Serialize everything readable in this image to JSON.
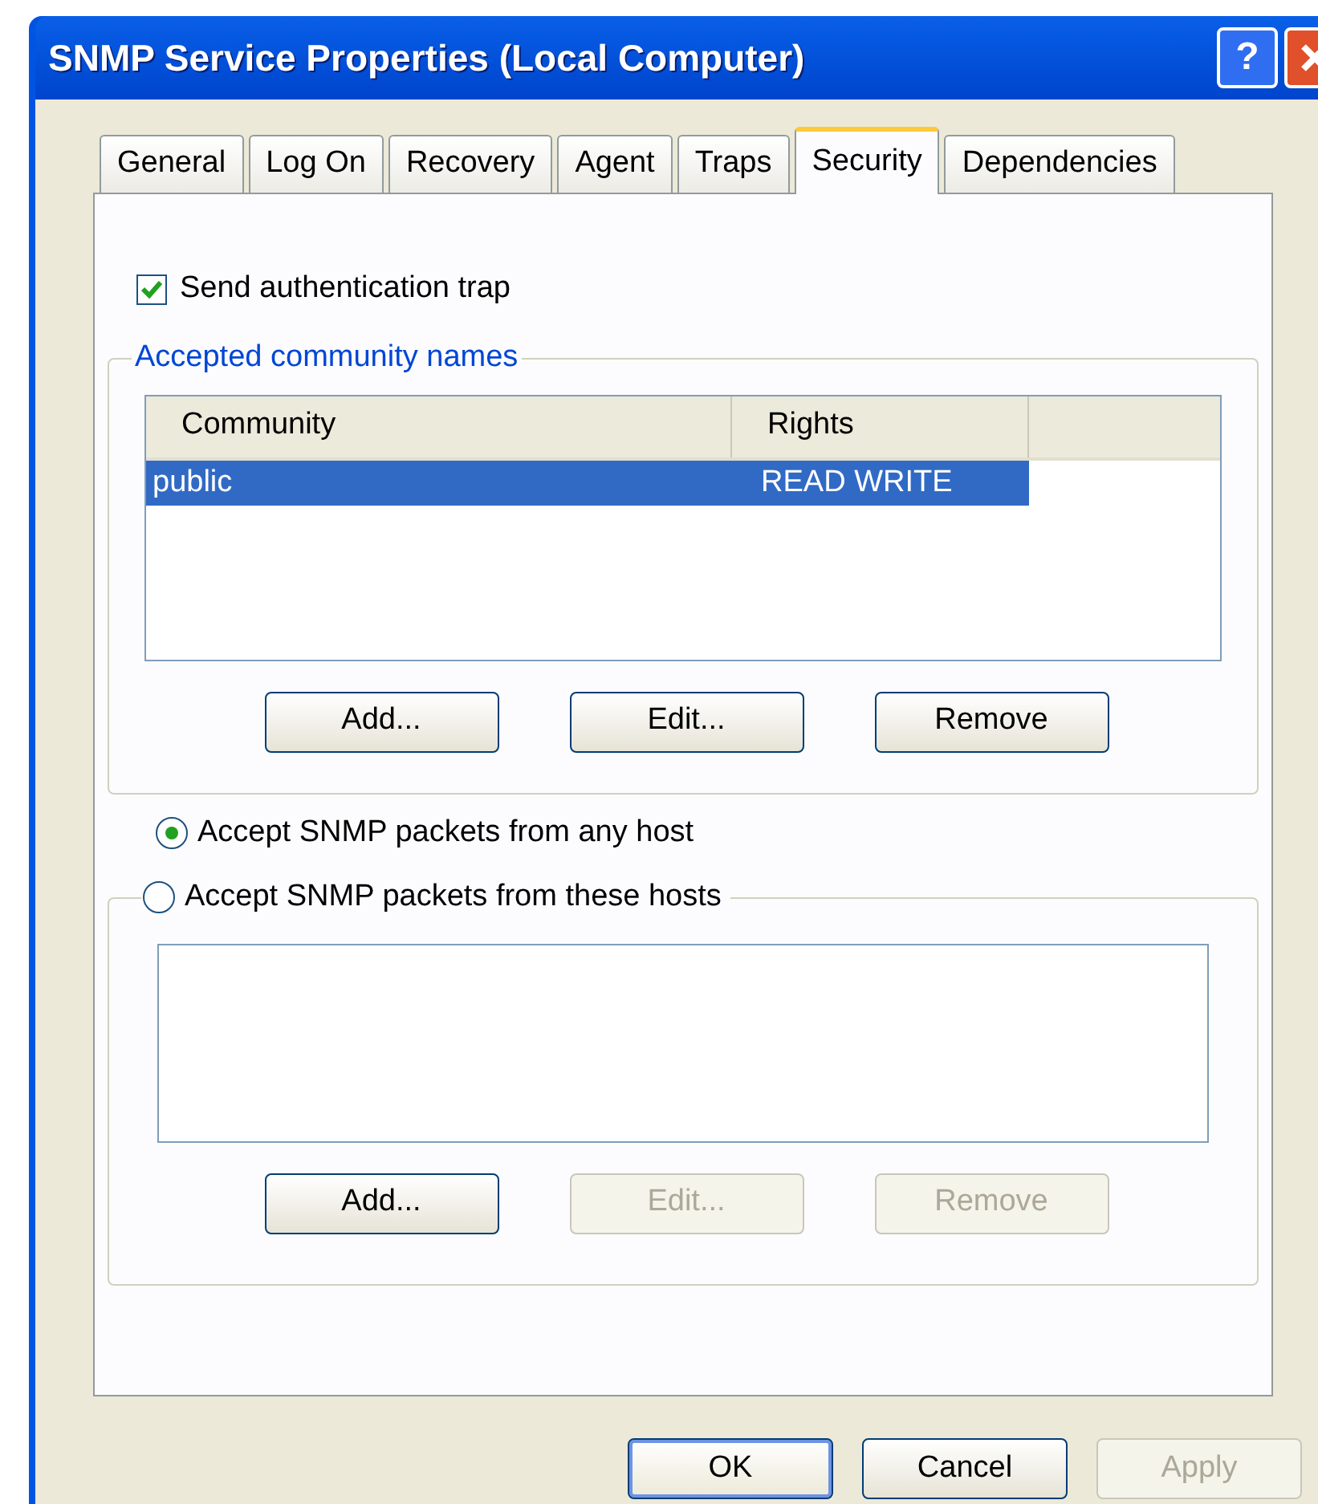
{
  "window": {
    "title": "SNMP Service Properties (Local Computer)",
    "help_button": "?"
  },
  "tabs": [
    {
      "label": "General",
      "selected": false
    },
    {
      "label": "Log On",
      "selected": false
    },
    {
      "label": "Recovery",
      "selected": false
    },
    {
      "label": "Agent",
      "selected": false
    },
    {
      "label": "Traps",
      "selected": false
    },
    {
      "label": "Security",
      "selected": true
    },
    {
      "label": "Dependencies",
      "selected": false
    }
  ],
  "auth_trap": {
    "label": "Send authentication trap",
    "checked": true
  },
  "community_group": {
    "title": "Accepted community names",
    "columns": [
      "Community",
      "Rights"
    ],
    "rows": [
      {
        "cells": [
          "public",
          "READ WRITE"
        ],
        "selected": true
      }
    ],
    "buttons": [
      {
        "label": "Add...",
        "disabled": false
      },
      {
        "label": "Edit...",
        "disabled": false
      },
      {
        "label": "Remove",
        "disabled": false
      }
    ]
  },
  "host_options": [
    {
      "label": "Accept SNMP packets from any host",
      "selected": true
    },
    {
      "label": "Accept SNMP packets from these hosts",
      "selected": false
    }
  ],
  "hosts_group": {
    "buttons": [
      {
        "label": "Add...",
        "disabled": false
      },
      {
        "label": "Edit...",
        "disabled": true
      },
      {
        "label": "Remove",
        "disabled": true
      }
    ]
  },
  "footer_buttons": [
    {
      "label": "OK",
      "disabled": false,
      "default": true
    },
    {
      "label": "Cancel",
      "disabled": false,
      "default": false
    },
    {
      "label": "Apply",
      "disabled": true,
      "default": false
    }
  ]
}
